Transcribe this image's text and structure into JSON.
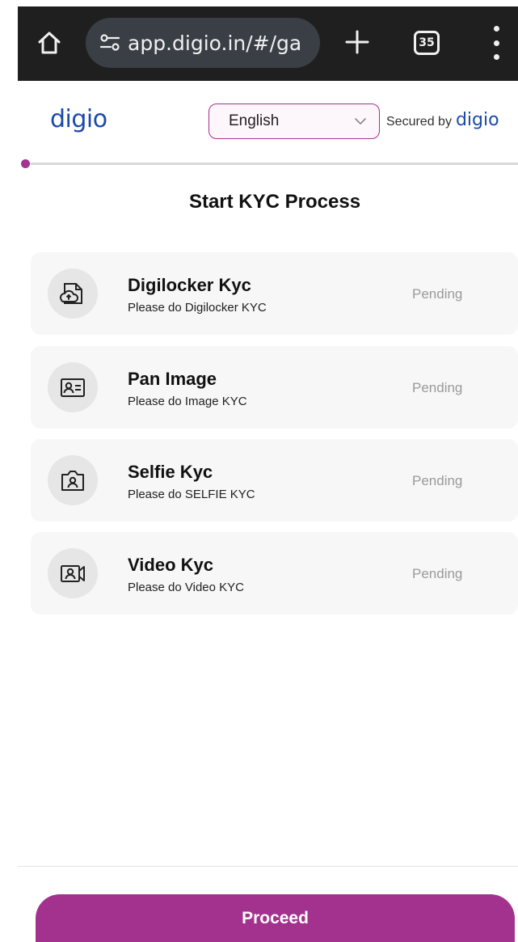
{
  "browser": {
    "url": "app.digio.in/#/ga",
    "tab_count": "35",
    "home_icon": "home-icon",
    "site_settings_icon": "tune-icon",
    "new_tab_icon": "plus-icon",
    "menu_icon": "more-vert-icon"
  },
  "header": {
    "logo_text": "digio",
    "language": {
      "selected": "English",
      "icon": "chevron-down-icon"
    },
    "secured_by_label": "Secured by",
    "secured_by_logo": "digio"
  },
  "progress": {
    "step_fraction": 0.0
  },
  "main": {
    "title": "Start KYC Process",
    "steps": [
      {
        "title": "Digilocker Kyc",
        "subtitle": "Please do Digilocker KYC",
        "status": "Pending",
        "icon": "cloud-document-icon"
      },
      {
        "title": "Pan Image",
        "subtitle": "Please do Image KYC",
        "status": "Pending",
        "icon": "id-card-icon"
      },
      {
        "title": "Selfie Kyc",
        "subtitle": "Please do SELFIE KYC",
        "status": "Pending",
        "icon": "camera-person-icon"
      },
      {
        "title": "Video Kyc",
        "subtitle": "Please do Video KYC",
        "status": "Pending",
        "icon": "video-person-icon"
      }
    ]
  },
  "footer": {
    "proceed_label": "Proceed"
  },
  "colors": {
    "brand_blue": "#1b4aa8",
    "accent_purple": "#a3328f",
    "browser_bar": "#1f1f1f",
    "status_gray": "#9a9a9a"
  }
}
